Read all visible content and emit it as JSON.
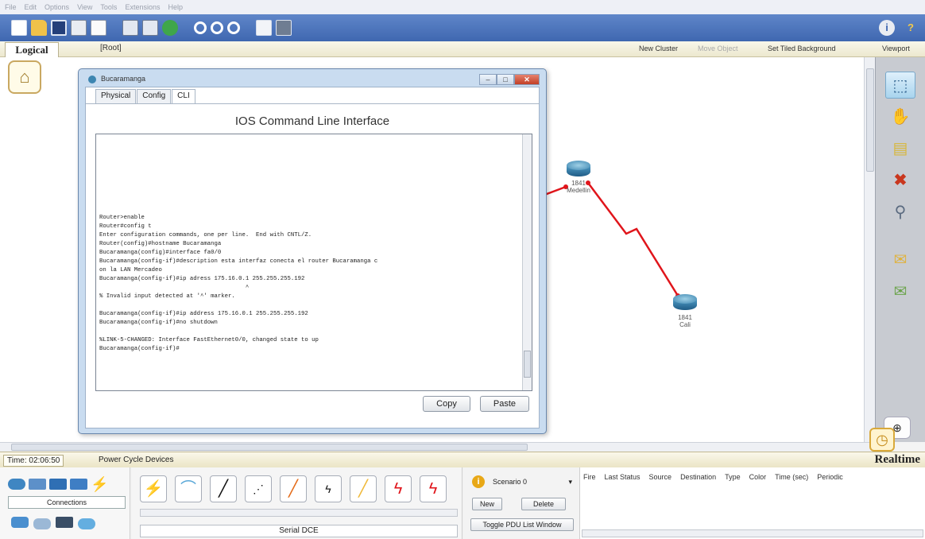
{
  "menubar": {
    "items": [
      "File",
      "Edit",
      "Options",
      "View",
      "Tools",
      "Extensions",
      "Help"
    ]
  },
  "toolbar": {
    "buttons": [
      "new-icon",
      "open-icon",
      "save-icon",
      "print-icon",
      "activity-wizard-icon",
      "copy-icon",
      "paste-icon",
      "undo-icon",
      "zoom-in-icon",
      "zoom-reset-icon",
      "zoom-out-icon",
      "drawing-palette-icon",
      "custom-devices-icon"
    ],
    "info_icon": "i",
    "help_icon": "?"
  },
  "workspace": {
    "tab": "Logical",
    "root": "[Root]",
    "new_cluster": "New Cluster",
    "move_object": "Move Object",
    "set_background": "Set Tiled Background",
    "viewport": "Viewport"
  },
  "devices": [
    {
      "model": "1841",
      "name": "Medellin"
    },
    {
      "model": "1841",
      "name": "Cali"
    }
  ],
  "dialog": {
    "title": "Bucaramanga",
    "controls": {
      "minimize": "–",
      "maximize": "□",
      "close": "✕"
    },
    "tabs": [
      "Physical",
      "Config",
      "CLI"
    ],
    "heading": "IOS Command Line Interface",
    "cli_lines": [
      "Router>enable",
      "Router#config t",
      "Enter configuration commands, one per line.  End with CNTL/Z.",
      "Router(config)#hostname Bucaramanga",
      "Bucaramanga(config)#interface fa0/0",
      "Bucaramanga(config-if)#description esta interfaz conecta el router Bucaramanga c",
      "on la LAN Mercadeo",
      "Bucaramanga(config-if)#ip adress 175.16.0.1 255.255.255.192",
      "                                          ^",
      "% Invalid input detected at '^' marker.",
      "",
      "Bucaramanga(config-if)#ip address 175.16.0.1 255.255.255.192",
      "Bucaramanga(config-if)#no shutdown",
      "",
      "%LINK-5-CHANGED: Interface FastEthernet0/0, changed state to up",
      "Bucaramanga(config-if)#"
    ],
    "copy_label": "Copy",
    "paste_label": "Paste"
  },
  "status": {
    "time": "Time: 02:06:50",
    "power_cycle": "Power Cycle Devices",
    "mode": "Realtime"
  },
  "bottom": {
    "category_label": "Connections",
    "connection_types": [
      "automatic-icon",
      "console-icon",
      "straight-through-icon",
      "crossover-icon",
      "fiber-icon",
      "phone-icon",
      "coaxial-icon",
      "serial-dce-icon",
      "serial-dte-icon"
    ],
    "selected_connection": "Serial DCE",
    "scenario": "Scenario 0",
    "new_label": "New",
    "delete_label": "Delete",
    "toggle_label": "Toggle PDU List Window",
    "pdu_columns": [
      "Fire",
      "Last Status",
      "Source",
      "Destination",
      "Type",
      "Color",
      "Time (sec)",
      "Periodic"
    ]
  },
  "colors": {
    "toolbar": "#4a72b9",
    "link": "#e0151b",
    "router": "#2f78a8"
  }
}
